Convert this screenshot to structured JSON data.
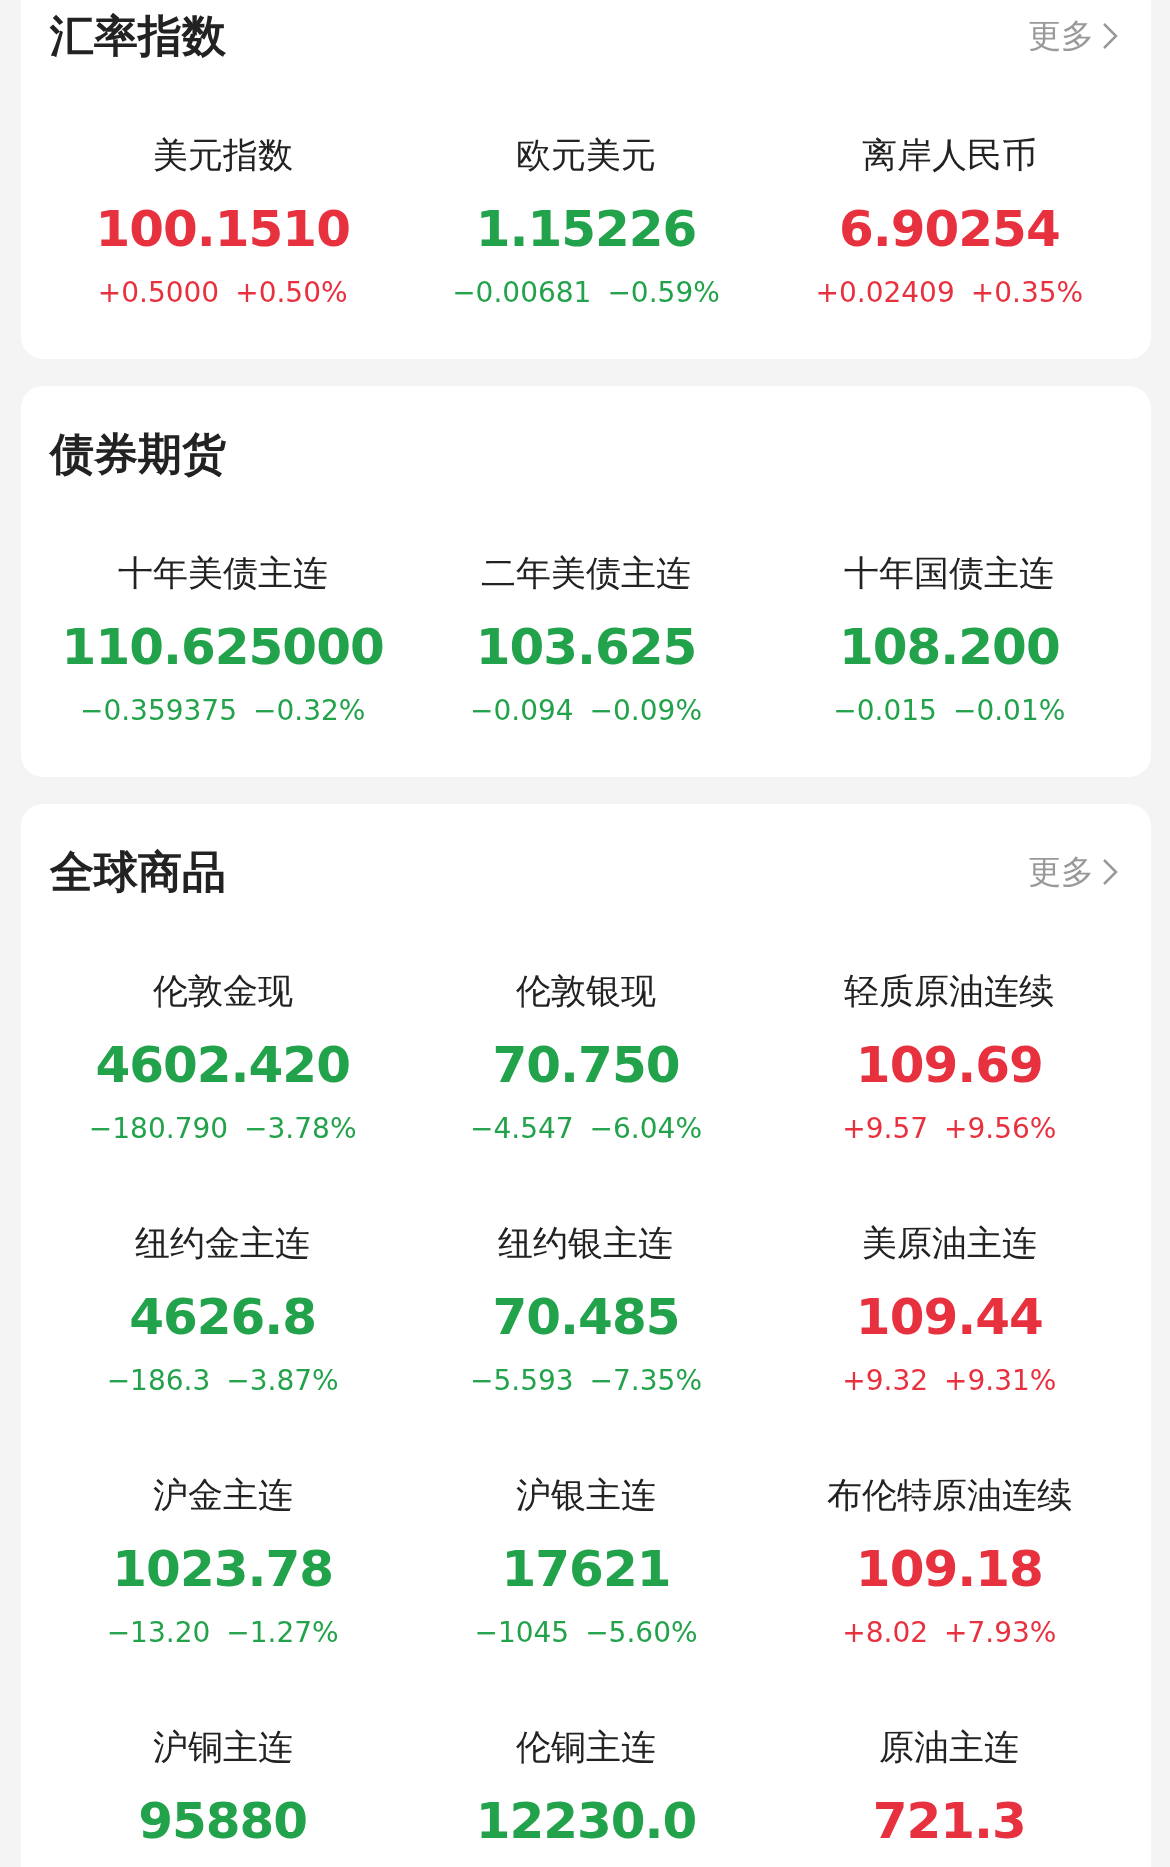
{
  "sections": [
    {
      "title": "汇率指数",
      "more": "更多",
      "items": [
        {
          "name": "美元指数",
          "value": "100.1510",
          "change": "+0.5000",
          "percent": "+0.50%",
          "color": "#e8313e"
        },
        {
          "name": "欧元美元",
          "value": "1.15226",
          "change": "−0.00681",
          "percent": "−0.59%",
          "color": "#22a24a"
        },
        {
          "name": "离岸人民币",
          "value": "6.90254",
          "change": "+0.02409",
          "percent": "+0.35%",
          "color": "#e8313e"
        }
      ]
    },
    {
      "title": "债券期货",
      "items": [
        {
          "name": "十年美债主连",
          "value": "110.625000",
          "change": "−0.359375",
          "percent": "−0.32%",
          "color": "#22a24a"
        },
        {
          "name": "二年美债主连",
          "value": "103.625",
          "change": "−0.094",
          "percent": "−0.09%",
          "color": "#22a24a"
        },
        {
          "name": "十年国债主连",
          "value": "108.200",
          "change": "−0.015",
          "percent": "−0.01%",
          "color": "#22a24a"
        }
      ]
    },
    {
      "title": "全球商品",
      "more": "更多",
      "items": [
        {
          "name": "伦敦金现",
          "value": "4602.420",
          "change": "−180.790",
          "percent": "−3.78%",
          "color": "#22a24a"
        },
        {
          "name": "伦敦银现",
          "value": "70.750",
          "change": "−4.547",
          "percent": "−6.04%",
          "color": "#22a24a"
        },
        {
          "name": "轻质原油连续",
          "value": "109.69",
          "change": "+9.57",
          "percent": "+9.56%",
          "color": "#e8313e"
        },
        {
          "name": "纽约金主连",
          "value": "4626.8",
          "change": "−186.3",
          "percent": "−3.87%",
          "color": "#22a24a"
        },
        {
          "name": "纽约银主连",
          "value": "70.485",
          "change": "−5.593",
          "percent": "−7.35%",
          "color": "#22a24a"
        },
        {
          "name": "美原油主连",
          "value": "109.44",
          "change": "+9.32",
          "percent": "+9.31%",
          "color": "#e8313e"
        },
        {
          "name": "沪金主连",
          "value": "1023.78",
          "change": "−13.20",
          "percent": "−1.27%",
          "color": "#22a24a"
        },
        {
          "name": "沪银主连",
          "value": "17621",
          "change": "−1045",
          "percent": "−5.60%",
          "color": "#22a24a"
        },
        {
          "name": "布伦特原油连续",
          "value": "109.18",
          "change": "+8.02",
          "percent": "+7.93%",
          "color": "#e8313e"
        },
        {
          "name": "沪铜主连",
          "value": "95880",
          "color": "#22a24a"
        },
        {
          "name": "伦铜主连",
          "value": "12230.0",
          "color": "#22a24a"
        },
        {
          "name": "原油主连",
          "value": "721.3",
          "color": "#e8313e"
        }
      ]
    }
  ]
}
